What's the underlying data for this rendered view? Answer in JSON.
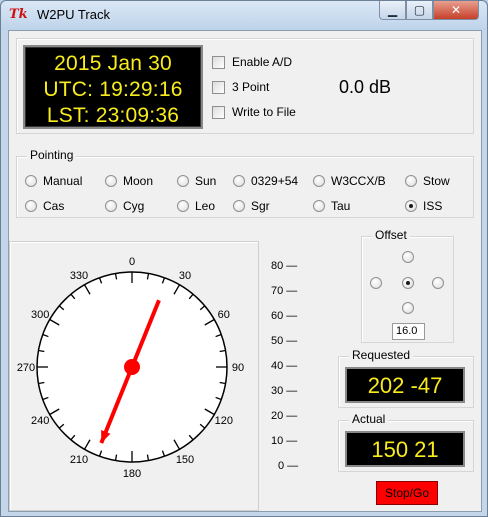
{
  "window": {
    "title": "W2PU Track",
    "icon": "Tk"
  },
  "clock": {
    "date": "2015 Jan 30",
    "utc": "UTC: 19:29:16",
    "lst": "LST: 23:09:36"
  },
  "options": [
    {
      "label": "Enable A/D",
      "checked": false
    },
    {
      "label": "3 Point",
      "checked": false
    },
    {
      "label": "Write to File",
      "checked": false
    }
  ],
  "level": "0.0 dB",
  "pointing": {
    "label": "Pointing",
    "row1": [
      "Manual",
      "Moon",
      "Sun",
      "0329+54",
      "W3CCX/B",
      "Stow"
    ],
    "row2": [
      "Cas",
      "Cyg",
      "Leo",
      "Sgr",
      "Tau",
      "ISS"
    ],
    "selected": "ISS"
  },
  "dial": {
    "labels": [
      "0",
      "30",
      "60",
      "90",
      "120",
      "150",
      "180",
      "210",
      "240",
      "270",
      "300",
      "330"
    ]
  },
  "elevation_scale": [
    "80",
    "70",
    "60",
    "50",
    "40",
    "30",
    "20",
    "10",
    "0"
  ],
  "offset": {
    "label": "Offset",
    "value": "16.0"
  },
  "requested": {
    "label": "Requested",
    "value": "202  -47"
  },
  "actual": {
    "label": "Actual",
    "value": "150  21"
  },
  "stopgo": "Stop/Go"
}
